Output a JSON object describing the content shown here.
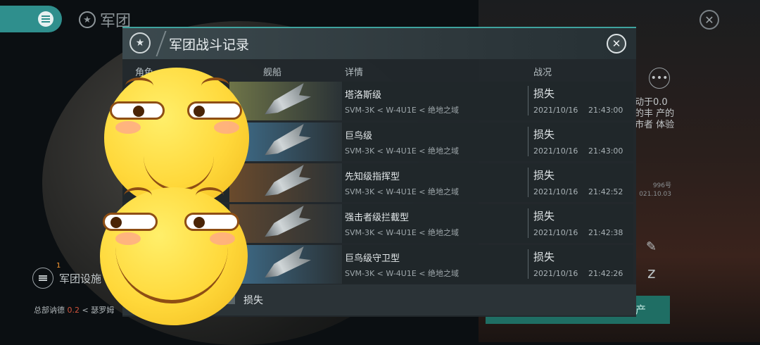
{
  "top": {
    "title": "军团"
  },
  "background": {
    "side_text": "动于0.0 的丰 产的 市者 体验",
    "side_small": "996号 021.10.03",
    "legion_label": "军团设施",
    "legion_badge": "1",
    "hq_prefix": "总部讷德",
    "hq_value": "0.2",
    "hq_suffix": "< 瑟罗姆",
    "green_button_label": "产"
  },
  "modal": {
    "title": "军团战斗记录",
    "columns": {
      "role": "角色",
      "ship": "舰船",
      "detail": "详情",
      "status": "战况"
    },
    "rows": [
      {
        "name": "塔洛斯级",
        "location": "SVM-3K < W-4U1E < 绝地之域",
        "status": "损失",
        "date": "2021/10/16",
        "time": "21:43:00",
        "bg": "#6e7448"
      },
      {
        "name": "巨鸟级",
        "location": "SVM-3K < W-4U1E < 绝地之域",
        "status": "损失",
        "date": "2021/10/16",
        "time": "21:43:00",
        "bg": "#3f6e8c"
      },
      {
        "name": "先知级指挥型",
        "location": "SVM-3K < W-4U1E < 绝地之域",
        "status": "损失",
        "date": "2021/10/16",
        "time": "21:42:52",
        "bg": "#6a4a2c"
      },
      {
        "name": "强击者级拦截型",
        "location": "SVM-3K < W-4U1E < 绝地之域",
        "status": "损失",
        "date": "2021/10/16",
        "time": "21:42:38",
        "bg": "#5d4630"
      },
      {
        "name": "巨鸟级守卫型",
        "location": "SVM-3K < W-4U1E < 绝地之域",
        "status": "损失",
        "date": "2021/10/16",
        "time": "21:42:26",
        "bg": "#3f6e8c"
      }
    ],
    "footer_filter_label": "损失"
  }
}
